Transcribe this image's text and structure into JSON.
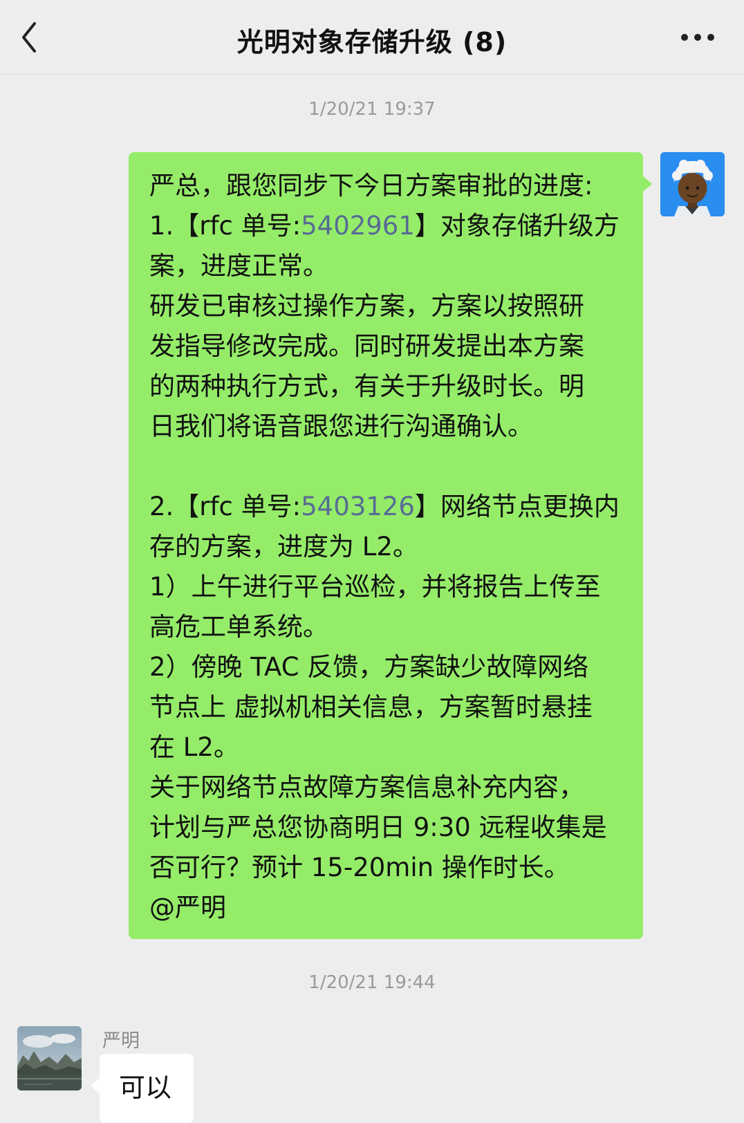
{
  "header": {
    "title": "光明对象存储升级 (8)",
    "back_icon": "chevron-left-icon",
    "more_icon": "more-dots-icon"
  },
  "messages": [
    {
      "timestamp": "1/20/21 19:37",
      "sender": "me",
      "avatar": "avatar-cartoon-white-hair",
      "lines": {
        "l1": "严总，跟您同步下今日方案审批的进度:",
        "l2a": "1.【rfc 单号:",
        "l2link": "5402961",
        "l2b": "】对象存储升级方",
        "l3": "案，进度正常。",
        "l4": "研发已审核过操作方案，方案以按照研",
        "l5": "发指导修改完成。同时研发提出本方案",
        "l6": "的两种执行方式，有关于升级时长。明",
        "l7": "日我们将语音跟您进行沟通确认。",
        "l8": "",
        "l9a": "2.【rfc 单号:",
        "l9link": "5403126",
        "l9b": "】网络节点更换内",
        "l10": "存的方案，进度为 L2。",
        "l11": "1）上午进行平台巡检，并将报告上传至",
        "l12": "高危工单系统。",
        "l13": "2）傍晚 TAC 反馈，方案缺少故障网络",
        "l14": "节点上 虚拟机相关信息，方案暂时悬挂",
        "l15": "在 L2。",
        "l16": "关于网络节点故障方案信息补充内容，",
        "l17": "计划与严总您协商明日 9:30 远程收集是",
        "l18": "否可行？预计 15-20min 操作时长。",
        "l19": "@严明"
      }
    },
    {
      "timestamp": "1/20/21 19:44",
      "sender": "严明",
      "avatar": "avatar-landscape-photo",
      "text": "可以"
    }
  ],
  "colors": {
    "background": "#ededed",
    "my_bubble": "#95ec69",
    "other_bubble": "#ffffff",
    "link": "#576b95",
    "timestamp": "#9a9a9a"
  }
}
